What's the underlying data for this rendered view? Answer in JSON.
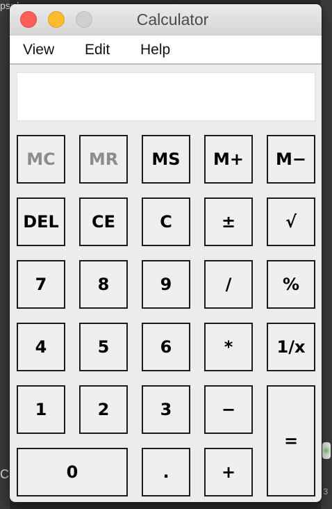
{
  "background": {
    "top_left_text": "pse/",
    "bottom_left_text": "C",
    "bottom_right_text": "3"
  },
  "window": {
    "title": "Calculator"
  },
  "menu": {
    "items": [
      "View",
      "Edit",
      "Help"
    ]
  },
  "display": {
    "value": ""
  },
  "keys": {
    "mc": "MC",
    "mr": "MR",
    "ms": "MS",
    "m_plus": "M+",
    "m_minus": "M−",
    "del": "DEL",
    "ce": "CE",
    "clear": "C",
    "plus_minus": "±",
    "sqrt": "√",
    "seven": "7",
    "eight": "8",
    "nine": "9",
    "divide": "/",
    "percent": "%",
    "four": "4",
    "five": "5",
    "six": "6",
    "multiply": "*",
    "reciprocal": "1/x",
    "one": "1",
    "two": "2",
    "three": "3",
    "minus": "−",
    "equals": "=",
    "zero": "0",
    "decimal": ".",
    "plus": "+"
  },
  "disabled_keys": [
    "MC",
    "MR"
  ],
  "colors": {
    "close": "#fc5f57",
    "minimize": "#fdbc2e",
    "zoom": "#cfcfcf",
    "disabled_text": "#8c8c8c"
  }
}
